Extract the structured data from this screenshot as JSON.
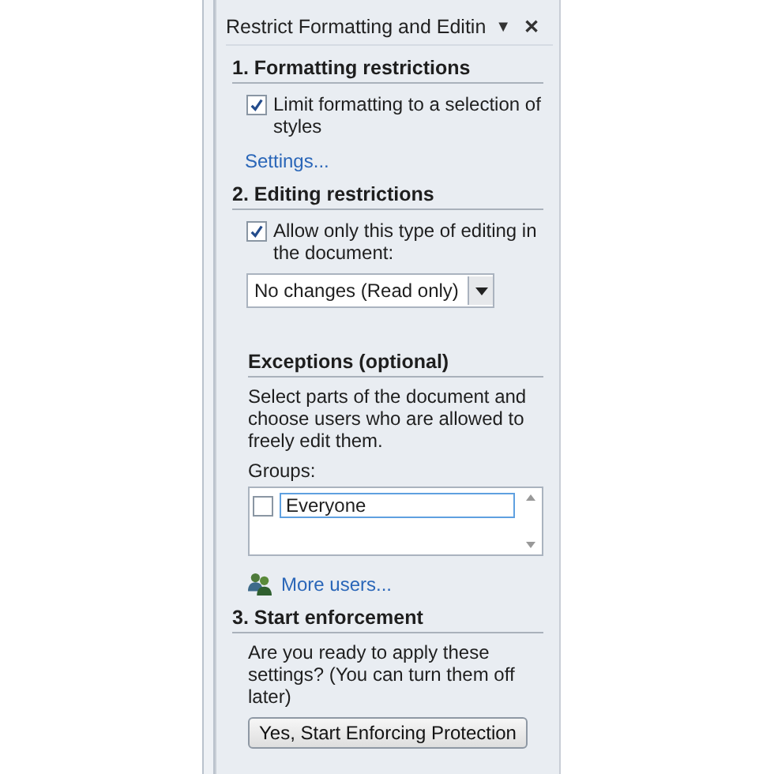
{
  "pane": {
    "title": "Restrict Formatting and Editin",
    "menu_glyph": "▼",
    "close_glyph": "✕"
  },
  "formatting": {
    "heading": "1. Formatting restrictions",
    "checkbox": {
      "label": "Limit formatting to a selection of styles",
      "checked": true
    },
    "link": "Settings..."
  },
  "editing": {
    "heading": "2. Editing restrictions",
    "checkbox": {
      "label": "Allow only this type of editing in the document:",
      "checked": true
    },
    "dropdown": {
      "value": "No changes (Read only)"
    }
  },
  "exceptions": {
    "heading": "Exceptions (optional)",
    "description": "Select parts of the document and choose users who are allowed to freely edit them.",
    "groups_label": "Groups:",
    "groups": [
      {
        "name": "Everyone",
        "checked": false
      }
    ],
    "link": "More users..."
  },
  "enforcement": {
    "heading": "3. Start enforcement",
    "description": "Are you ready to apply these settings? (You can turn them off later)",
    "button": "Yes, Start Enforcing Protection"
  }
}
